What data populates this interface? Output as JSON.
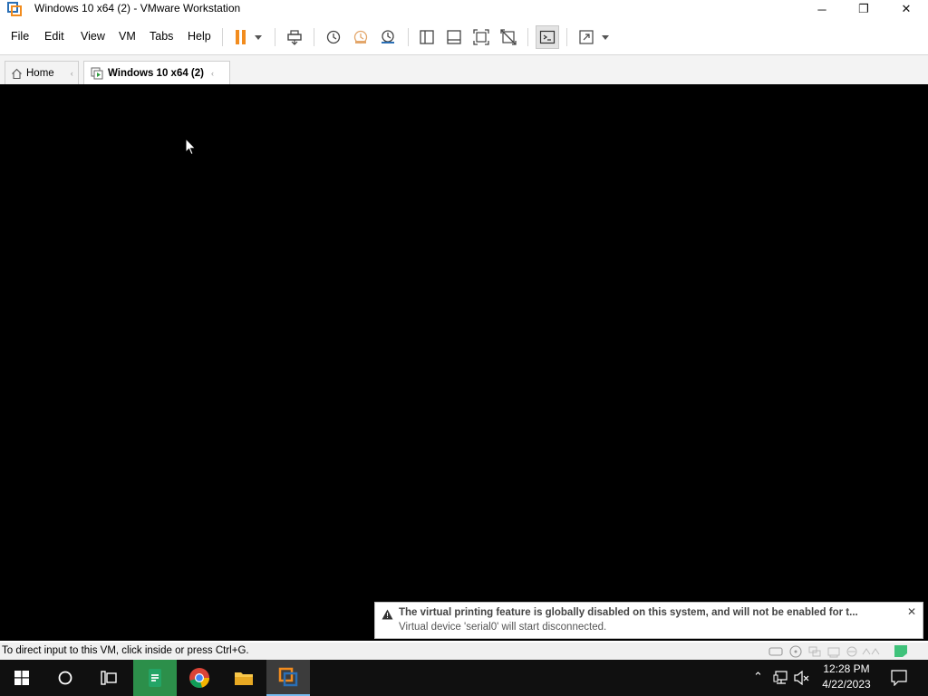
{
  "window": {
    "title": "Windows 10 x64 (2) - VMware Workstation",
    "minimize": "─",
    "restore": "❐",
    "close": "✕"
  },
  "menu": [
    {
      "label": "File"
    },
    {
      "label": "Edit"
    },
    {
      "label": "View"
    },
    {
      "label": "VM"
    },
    {
      "label": "Tabs"
    },
    {
      "label": "Help"
    }
  ],
  "toolbar": {
    "icons": [
      "pause-icon",
      "dropdown-arrow-icon",
      "send-ctrl-alt-del-icon",
      "snapshot-icon",
      "revert-snapshot-icon",
      "snapshot-manager-icon",
      "show-library-icon",
      "thumbnail-bar-icon",
      "full-screen-icon",
      "unity-icon",
      "console-view-icon",
      "stretch-icon"
    ]
  },
  "tabs": {
    "home": "Home",
    "vm": "Windows 10 x64 (2)"
  },
  "notification": {
    "line1": "The virtual printing feature is globally disabled on this system, and will not be enabled for t...",
    "line2": "Virtual device 'serial0' will start disconnected.",
    "close": "✕"
  },
  "status": {
    "text": "To direct input to this VM, click inside or press Ctrl+G."
  },
  "taskbar": {
    "time": "12:28 PM",
    "date": "4/22/2023"
  },
  "colors": {
    "pause_orange": "#f28c1e",
    "vm_background": "#000000",
    "taskbar": "#101010",
    "accent": "#76b9ed"
  }
}
